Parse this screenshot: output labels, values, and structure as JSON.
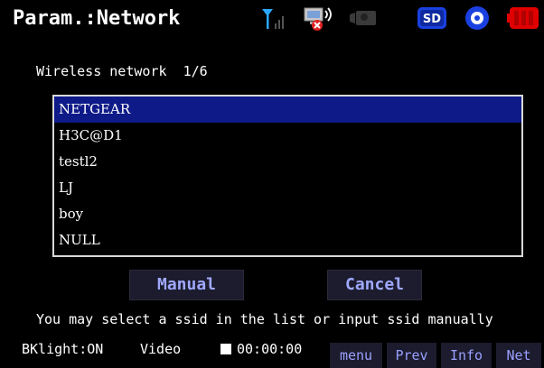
{
  "header": {
    "title": "Param.:Network",
    "icons": [
      "signal-icon",
      "network-disconnected-icon",
      "camera-icon",
      "sd-card-icon",
      "disc-icon",
      "battery-icon"
    ]
  },
  "wireless": {
    "label": "Wireless network",
    "page": "1/6",
    "items": [
      "NETGEAR",
      "H3C@D1",
      "testl2",
      "LJ",
      "boy",
      "NULL"
    ],
    "selected_index": 0
  },
  "buttons": {
    "manual": "Manual",
    "cancel": "Cancel"
  },
  "hint": "You may select a ssid in the list or input ssid manually",
  "statusbar": {
    "backlight": "BKlight:ON",
    "video": "Video",
    "timer": "00:00:00",
    "softkeys": [
      "menu",
      "Prev",
      "Info",
      "Net"
    ]
  },
  "colors": {
    "selection": "#0e1a88",
    "button_text": "#a0a8ff",
    "battery": "#e00000",
    "icon_blue": "#1a40e0"
  }
}
